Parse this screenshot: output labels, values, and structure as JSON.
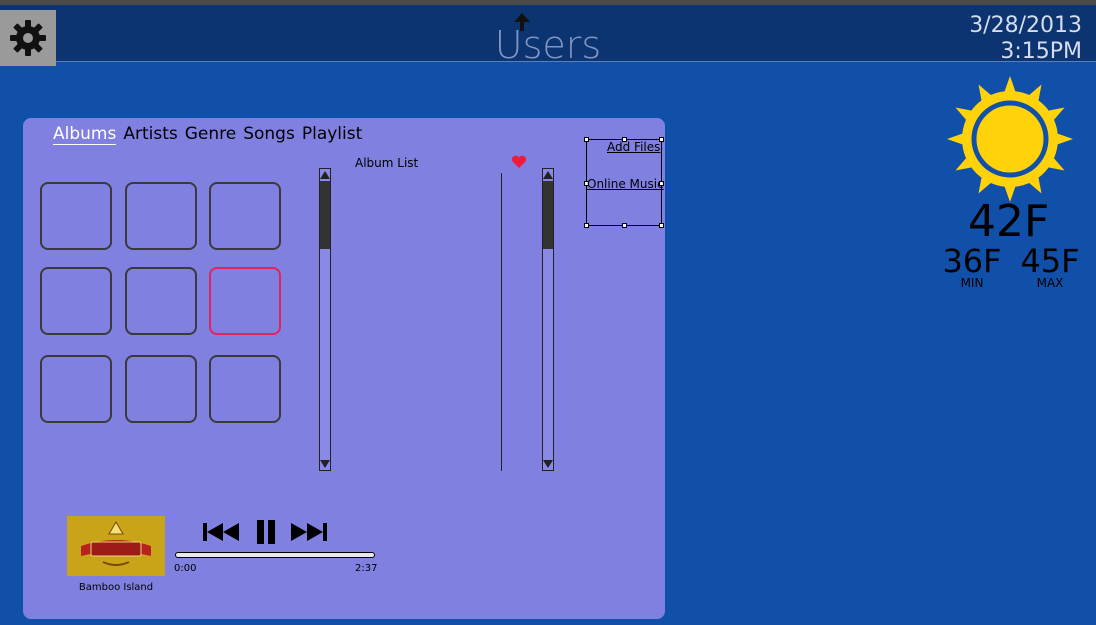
{
  "header": {
    "title": "Users",
    "date": "3/28/2013",
    "time": "3:15PM"
  },
  "weather": {
    "current": "42F",
    "min": "36F",
    "max": "45F",
    "min_label": "MIN",
    "max_label": "MAX",
    "icon": "sun-icon"
  },
  "tabs": [
    {
      "label": "Albums",
      "active": true
    },
    {
      "label": "Artists",
      "active": false
    },
    {
      "label": "Genre",
      "active": false
    },
    {
      "label": "Songs",
      "active": false
    },
    {
      "label": "Playlist",
      "active": false
    }
  ],
  "album_list_label": "Album List",
  "popup": {
    "add_files": "Add Files",
    "online_music": "Online Music"
  },
  "now_playing": {
    "song": "Bamboo Island",
    "elapsed": "0:00",
    "duration": "2:37",
    "progress": 0
  },
  "colors": {
    "background": "#1150a8",
    "header": "#0b3470",
    "panel": "#7f80e0",
    "accent": "#e0245e",
    "sun": "#ffd20a"
  }
}
